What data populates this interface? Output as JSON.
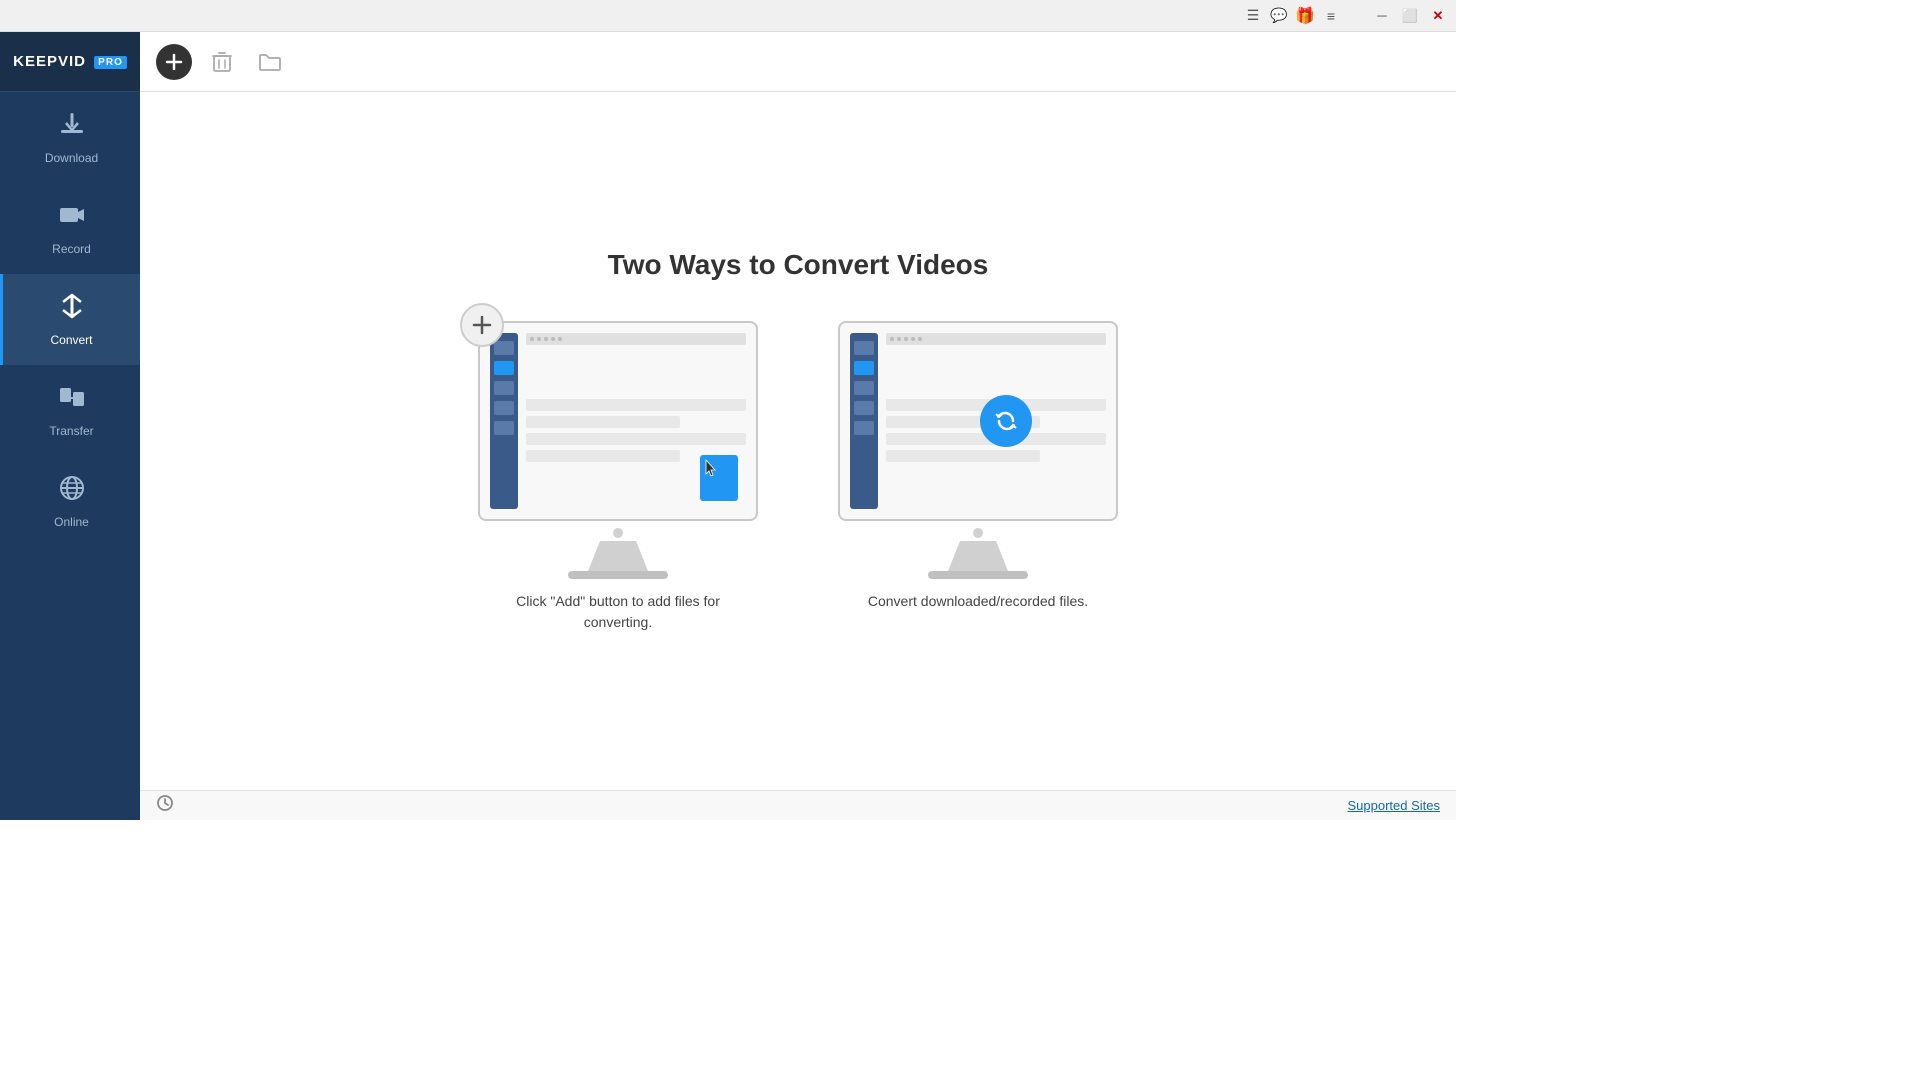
{
  "titlebar": {
    "icons": [
      "menu-icon",
      "qq-icon",
      "gift-icon",
      "hamburger-icon"
    ],
    "win_buttons": [
      "minimize",
      "maximize",
      "close"
    ]
  },
  "logo": {
    "name": "KEEPVID",
    "badge": "PRO"
  },
  "sidebar": {
    "items": [
      {
        "id": "download",
        "label": "Download",
        "icon": "⬇"
      },
      {
        "id": "record",
        "label": "Record",
        "icon": "📹"
      },
      {
        "id": "convert",
        "label": "Convert",
        "icon": "🔄"
      },
      {
        "id": "transfer",
        "label": "Transfer",
        "icon": "📤"
      },
      {
        "id": "online",
        "label": "Online",
        "icon": "🌐"
      }
    ],
    "active": "convert"
  },
  "toolbar": {
    "add_label": "+",
    "delete_label": "🗑",
    "folder_label": "📁"
  },
  "main": {
    "heading": "Two Ways to Convert Videos",
    "card1": {
      "caption": "Click \"Add\" button to add files for converting."
    },
    "card2": {
      "caption": "Convert downloaded/recorded files."
    }
  },
  "statusbar": {
    "supported_sites_label": "Supported Sites"
  }
}
